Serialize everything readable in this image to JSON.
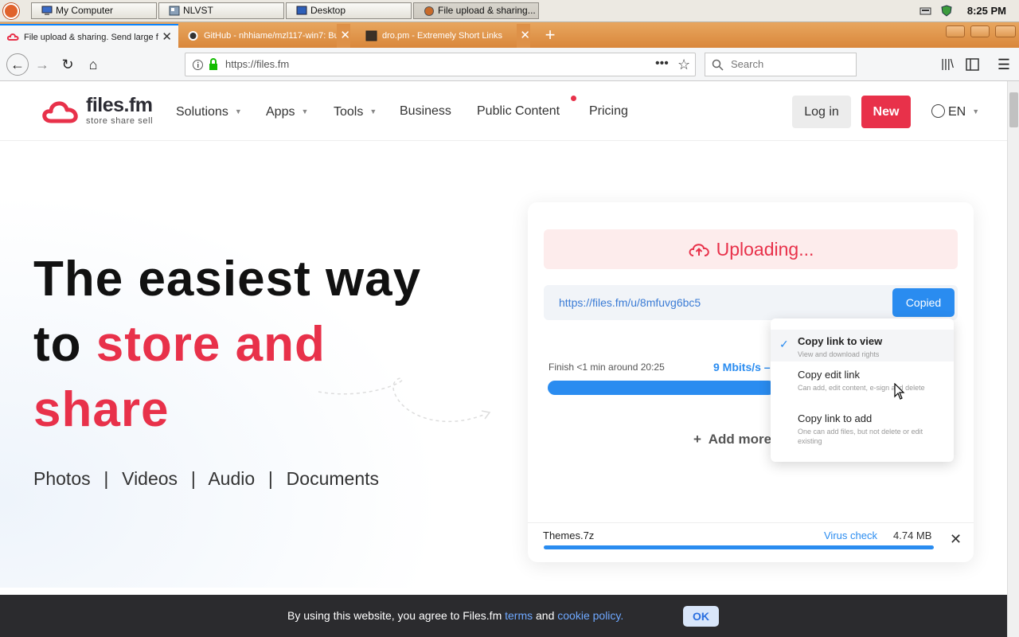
{
  "taskbar": {
    "windows": [
      {
        "label": "My Computer"
      },
      {
        "label": "NLVST"
      },
      {
        "label": "Desktop"
      },
      {
        "label": "File upload & sharing..."
      }
    ],
    "clock": "8:25 PM"
  },
  "browser": {
    "tabs": [
      {
        "label": "File upload & sharing. Send large f"
      },
      {
        "label": "GitHub - nhhiame/mzl117-win7: Bu"
      },
      {
        "label": "dro.pm - Extremely Short Links"
      }
    ],
    "new_tab": "+",
    "url": "https://files.fm",
    "search_placeholder": "Search"
  },
  "site": {
    "logo": {
      "name": "files.fm",
      "tagline": "store  share  sell"
    },
    "nav": [
      "Solutions",
      "Apps",
      "Tools",
      "Business",
      "Public Content",
      "Pricing"
    ],
    "login": "Log in",
    "new": "New",
    "lang": "EN"
  },
  "hero": {
    "line1": "The easiest way",
    "line2_prefix": "to ",
    "line2_highlight": "store and",
    "line3": "share",
    "types": "Photos  |  Videos  |  Audio  |  Documents"
  },
  "upload": {
    "status": "Uploading...",
    "link": "https://files.fm/u/8mfuvg6bc5",
    "copied": "Copied",
    "finish": "Finish <1 min around 20:25",
    "speed": "9 Mbits/s –",
    "add_more": "+  Add more",
    "progress_fraction": 0.55,
    "file": {
      "name": "Themes.7z",
      "virus_check": "Virus check",
      "size": "4.74 MB",
      "close": "✕",
      "progress_fraction": 1.0
    }
  },
  "dropdown": {
    "options": [
      {
        "title": "Copy link to view",
        "desc": "View and download rights"
      },
      {
        "title": "Copy edit link",
        "desc": "Can add, edit content, e-sign and delete"
      },
      {
        "title": "Copy link to add",
        "desc": "One can add files, but not delete or edit existing"
      }
    ],
    "selected_index": 0
  },
  "cookie": {
    "text_before": "By using this website, you agree to Files.fm ",
    "terms": "terms",
    "and": " and ",
    "policy": "cookie policy.",
    "ok": "OK"
  },
  "colors": {
    "brand_red": "#e8314a",
    "accent_blue": "#2a8cf0",
    "tab_orange": "#d9873b"
  }
}
